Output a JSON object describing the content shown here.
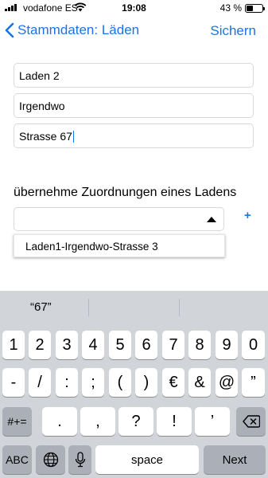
{
  "status_bar": {
    "carrier": "vodafone ES",
    "time": "19:08",
    "battery_text": "43 %",
    "battery_level": 0.43
  },
  "nav": {
    "back_label": "Stammdaten: Läden",
    "save_label": "Sichern"
  },
  "form": {
    "name_value": "Laden 2",
    "city_value": "Irgendwo",
    "street_value": "Strasse 67"
  },
  "assign": {
    "label": "übernehme Zuordnungen eines Ladens",
    "selected": "",
    "add_label": "+",
    "options": [
      "Laden1-Irgendwo-Strasse 3"
    ]
  },
  "keyboard": {
    "suggestions": [
      "“67”",
      "",
      ""
    ],
    "row1": [
      "1",
      "2",
      "3",
      "4",
      "5",
      "6",
      "7",
      "8",
      "9",
      "0"
    ],
    "row2": [
      "-",
      "/",
      ":",
      ";",
      "(",
      ")",
      "€",
      "&",
      "@",
      "”"
    ],
    "row3": [
      ".",
      ",",
      "?",
      "!",
      "’"
    ],
    "symbols_label": "#+=",
    "abc_label": "ABC",
    "space_label": "space",
    "next_label": "Next"
  }
}
